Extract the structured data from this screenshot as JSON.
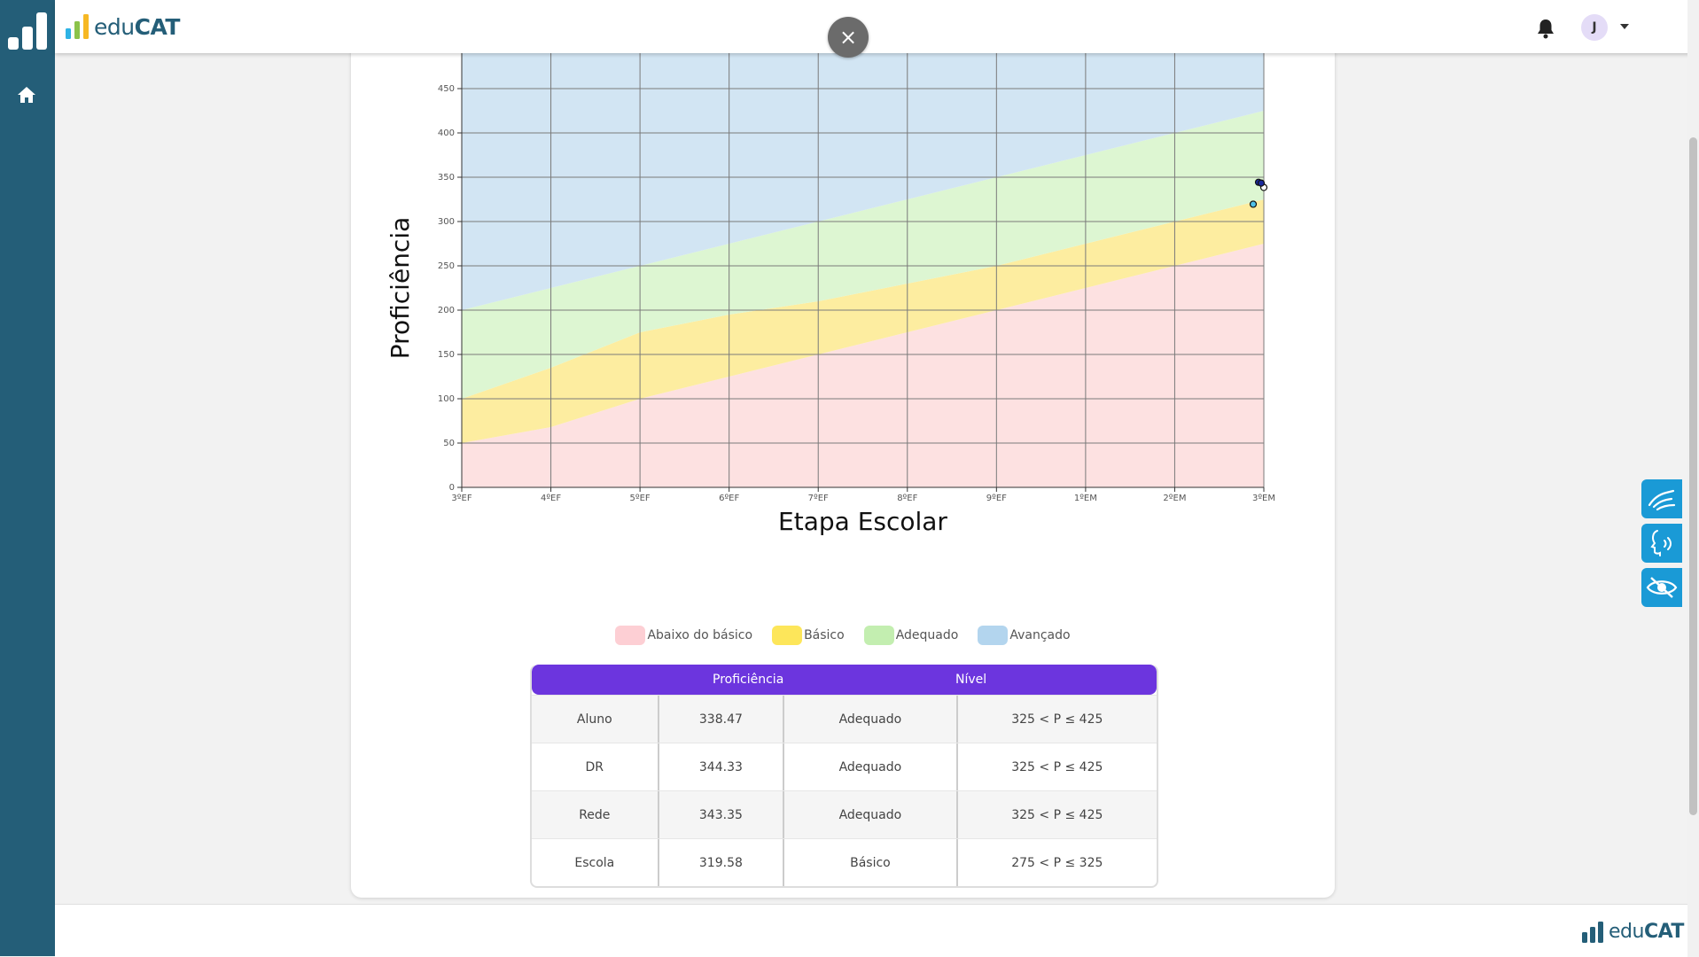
{
  "brand": {
    "pre": "edu",
    "bold": "CAT"
  },
  "user": {
    "initial": "J"
  },
  "close_label": "×",
  "chart_data": {
    "type": "area",
    "xlabel": "Etapa Escolar",
    "ylabel": "Proficiência",
    "categories": [
      "3ºEF",
      "4ºEF",
      "5ºEF",
      "6ºEF",
      "7ºEF",
      "8ºEF",
      "9ºEF",
      "1ºEM",
      "2ºEM",
      "3ºEM"
    ],
    "ylim": [
      0,
      500
    ],
    "yticks": [
      0,
      50,
      100,
      150,
      200,
      250,
      300,
      350,
      400,
      450
    ],
    "grid": true,
    "bands": [
      {
        "name": "Abaixo do básico",
        "color": "#fde1e1",
        "upper": [
          50,
          68,
          100,
          125,
          150,
          175,
          200,
          225,
          250,
          275
        ]
      },
      {
        "name": "Básico",
        "color": "#fdeda0",
        "upper": [
          100,
          135,
          175,
          195,
          210,
          230,
          250,
          275,
          300,
          325
        ]
      },
      {
        "name": "Adequado",
        "color": "#ddf6d2",
        "upper": [
          200,
          225,
          250,
          275,
          300,
          325,
          350,
          375,
          400,
          425
        ]
      },
      {
        "name": "Avançado",
        "color": "#d2e5f3",
        "upper": [
          500,
          500,
          500,
          500,
          500,
          500,
          500,
          500,
          500,
          500
        ]
      }
    ],
    "points": [
      {
        "name": "Aluno",
        "x": 9,
        "y": 338.47,
        "color": "#ffffff"
      },
      {
        "name": "DR",
        "x": 9,
        "y": 344.33,
        "color": "#1b2a9e"
      },
      {
        "name": "Rede",
        "x": 9,
        "y": 343.35,
        "color": "#1b2a9e"
      },
      {
        "name": "Escola",
        "x": 9,
        "y": 319.58,
        "color": "#4fc1e9"
      }
    ]
  },
  "legend": [
    {
      "label": "Abaixo do básico",
      "color": "#fdcfd4"
    },
    {
      "label": "Básico",
      "color": "#fde65a"
    },
    {
      "label": "Adequado",
      "color": "#c3eeb0"
    },
    {
      "label": "Avançado",
      "color": "#b3d5ee"
    }
  ],
  "table": {
    "headers": [
      "Proficiência",
      "Nível"
    ],
    "rows": [
      {
        "label": "Aluno",
        "value": "338.47",
        "level": "Adequado",
        "range": "325 < P ≤ 425"
      },
      {
        "label": "DR",
        "value": "344.33",
        "level": "Adequado",
        "range": "325 < P ≤ 425"
      },
      {
        "label": "Rede",
        "value": "343.35",
        "level": "Adequado",
        "range": "325 < P ≤ 425"
      },
      {
        "label": "Escola",
        "value": "319.58",
        "level": "Básico",
        "range": "275 < P ≤ 325"
      }
    ]
  },
  "accessibility": [
    {
      "name": "sign-language-icon"
    },
    {
      "name": "voice-reader-icon"
    },
    {
      "name": "visibility-icon"
    }
  ]
}
